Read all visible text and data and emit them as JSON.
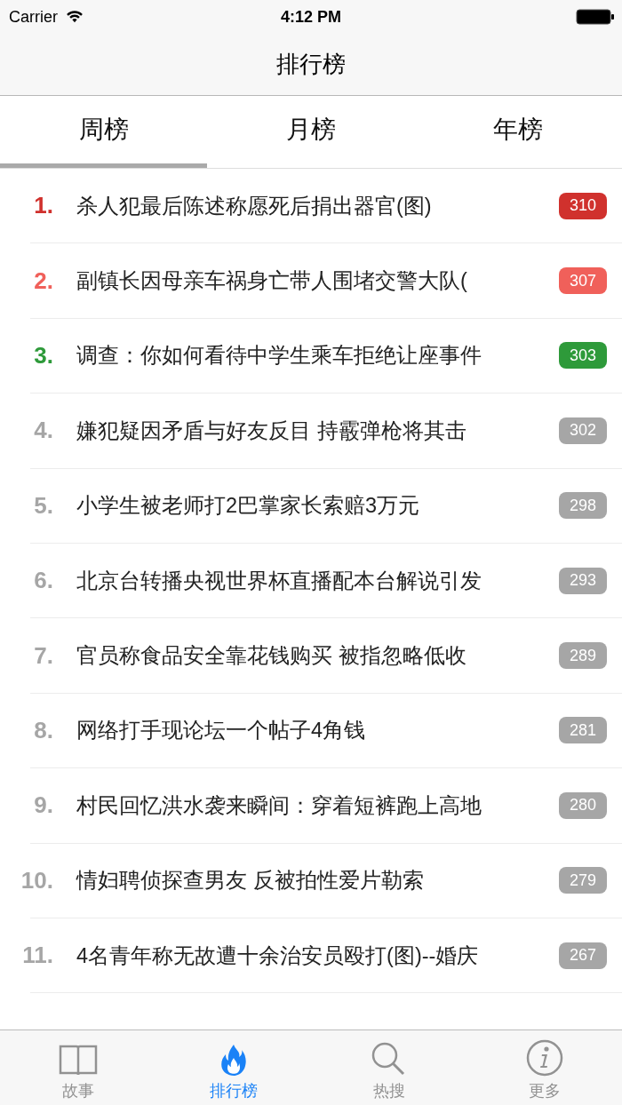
{
  "status_bar": {
    "carrier": "Carrier",
    "time": "4:12 PM"
  },
  "nav_bar": {
    "title": "排行榜"
  },
  "tabs": [
    {
      "label": "周榜",
      "selected": true
    },
    {
      "label": "月榜",
      "selected": false
    },
    {
      "label": "年榜",
      "selected": false
    }
  ],
  "rankings": [
    {
      "rank": "1.",
      "title": "杀人犯最后陈述称愿死后捐出器官(图)",
      "count": "310",
      "color": "#d0312d"
    },
    {
      "rank": "2.",
      "title": "副镇长因母亲车祸身亡带人围堵交警大队(",
      "count": "307",
      "color": "#f0605a"
    },
    {
      "rank": "3.",
      "title": "调查：你如何看待中学生乘车拒绝让座事件",
      "count": "303",
      "color": "#2e9a3a"
    },
    {
      "rank": "4.",
      "title": "嫌犯疑因矛盾与好友反目 持霰弹枪将其击",
      "count": "302",
      "color": "#a6a6a6"
    },
    {
      "rank": "5.",
      "title": "小学生被老师打2巴掌家长索赔3万元",
      "count": "298",
      "color": "#a6a6a6"
    },
    {
      "rank": "6.",
      "title": "北京台转播央视世界杯直播配本台解说引发",
      "count": "293",
      "color": "#a6a6a6"
    },
    {
      "rank": "7.",
      "title": "官员称食品安全靠花钱购买 被指忽略低收",
      "count": "289",
      "color": "#a6a6a6"
    },
    {
      "rank": "8.",
      "title": "网络打手现论坛一个帖子4角钱",
      "count": "281",
      "color": "#a6a6a6"
    },
    {
      "rank": "9.",
      "title": "村民回忆洪水袭来瞬间：穿着短裤跑上高地",
      "count": "280",
      "color": "#a6a6a6"
    },
    {
      "rank": "10.",
      "title": "情妇聘侦探查男友 反被拍性爱片勒索",
      "count": "279",
      "color": "#a6a6a6"
    },
    {
      "rank": "11.",
      "title": "4名青年称无故遭十余治安员殴打(图)--婚庆",
      "count": "267",
      "color": "#a6a6a6"
    }
  ],
  "tab_bar": [
    {
      "kind": "book",
      "label": "故事",
      "selected": false
    },
    {
      "kind": "flame",
      "label": "排行榜",
      "selected": true
    },
    {
      "kind": "search",
      "label": "热搜",
      "selected": false
    },
    {
      "kind": "info",
      "label": "更多",
      "selected": false
    }
  ]
}
